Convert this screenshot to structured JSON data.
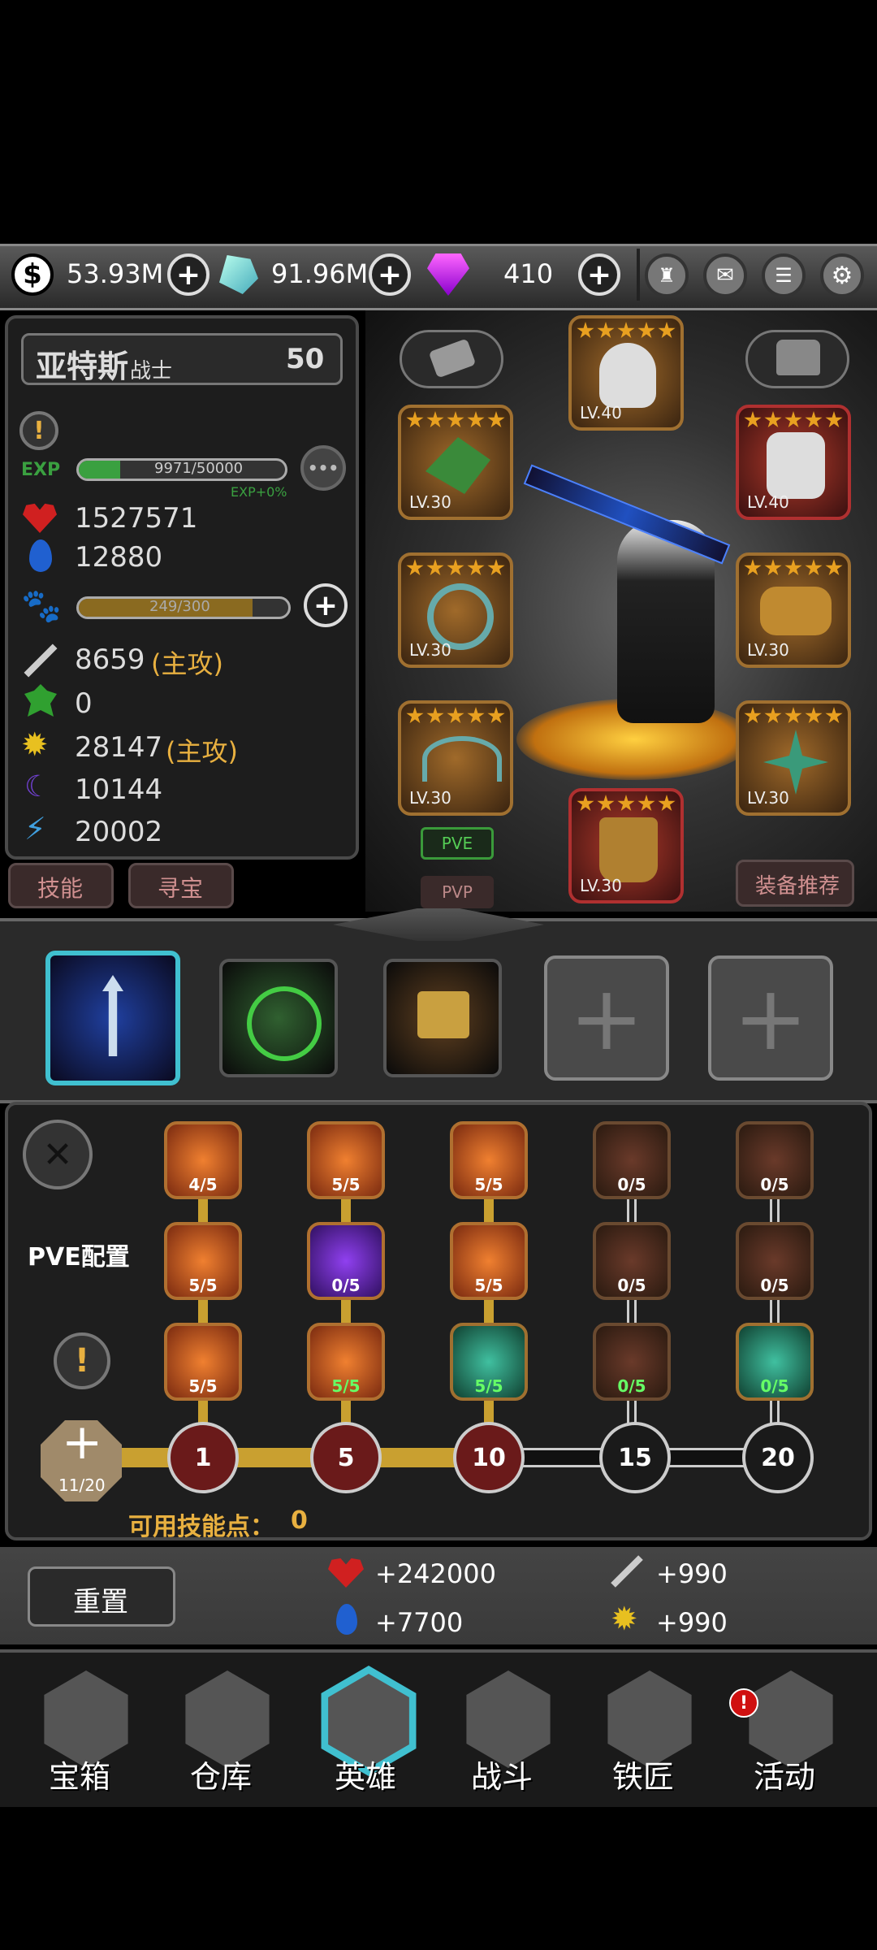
{
  "currency": {
    "gold": "53.93M",
    "crystal": "91.96M",
    "gem": "410"
  },
  "hero": {
    "name": "亚特斯",
    "class": "战士",
    "level": "50",
    "exp_label": "EXP",
    "exp_value": "9971/50000",
    "exp_fraction": 0.199,
    "exp_bonus": "EXP+0%",
    "more": "•••",
    "pet_value": "249/300",
    "pet_fraction": 0.83,
    "stats": {
      "hp": "1527571",
      "mp": "12880",
      "attack": "8659",
      "attack_tag": "(主攻)",
      "luck": "0",
      "magic": "28147",
      "magic_tag": "(主攻)",
      "defense": "10144",
      "speed": "20002"
    }
  },
  "left_buttons": {
    "skill": "技能",
    "treasure": "寻宝"
  },
  "equipment": {
    "slots": [
      {
        "lv": "LV.40"
      },
      {
        "lv": "LV.30"
      },
      {
        "lv": "LV.40"
      },
      {
        "lv": "LV.30"
      },
      {
        "lv": "LV.30"
      },
      {
        "lv": "LV.30"
      },
      {
        "lv": "LV.30"
      },
      {
        "lv": "LV.30"
      }
    ],
    "pve": "PVE",
    "pvp": "PVP",
    "recommend": "装备推荐"
  },
  "skill_panel": {
    "config_label": "PVE配置",
    "rows": [
      [
        "4/5",
        "5/5",
        "5/5",
        "0/5",
        "0/5"
      ],
      [
        "5/5",
        "0/5",
        "5/5",
        "0/5",
        "0/5"
      ],
      [
        "5/5",
        "5/5",
        "5/5",
        "0/5",
        "0/5"
      ]
    ],
    "progress": "11/20",
    "levels": [
      "1",
      "5",
      "10",
      "15",
      "20"
    ],
    "points_label": "可用技能点：",
    "points": "0"
  },
  "bonus": {
    "reset": "重置",
    "hp": "+242000",
    "attack": "+990",
    "mp": "+7700",
    "magic": "+990"
  },
  "tabs": [
    "宝箱",
    "仓库",
    "英雄",
    "战斗",
    "铁匠",
    "活动"
  ],
  "colors": {
    "accent_gold": "#e8b040",
    "exp_green": "#3aa040",
    "active_tab": "#40c0d0"
  }
}
